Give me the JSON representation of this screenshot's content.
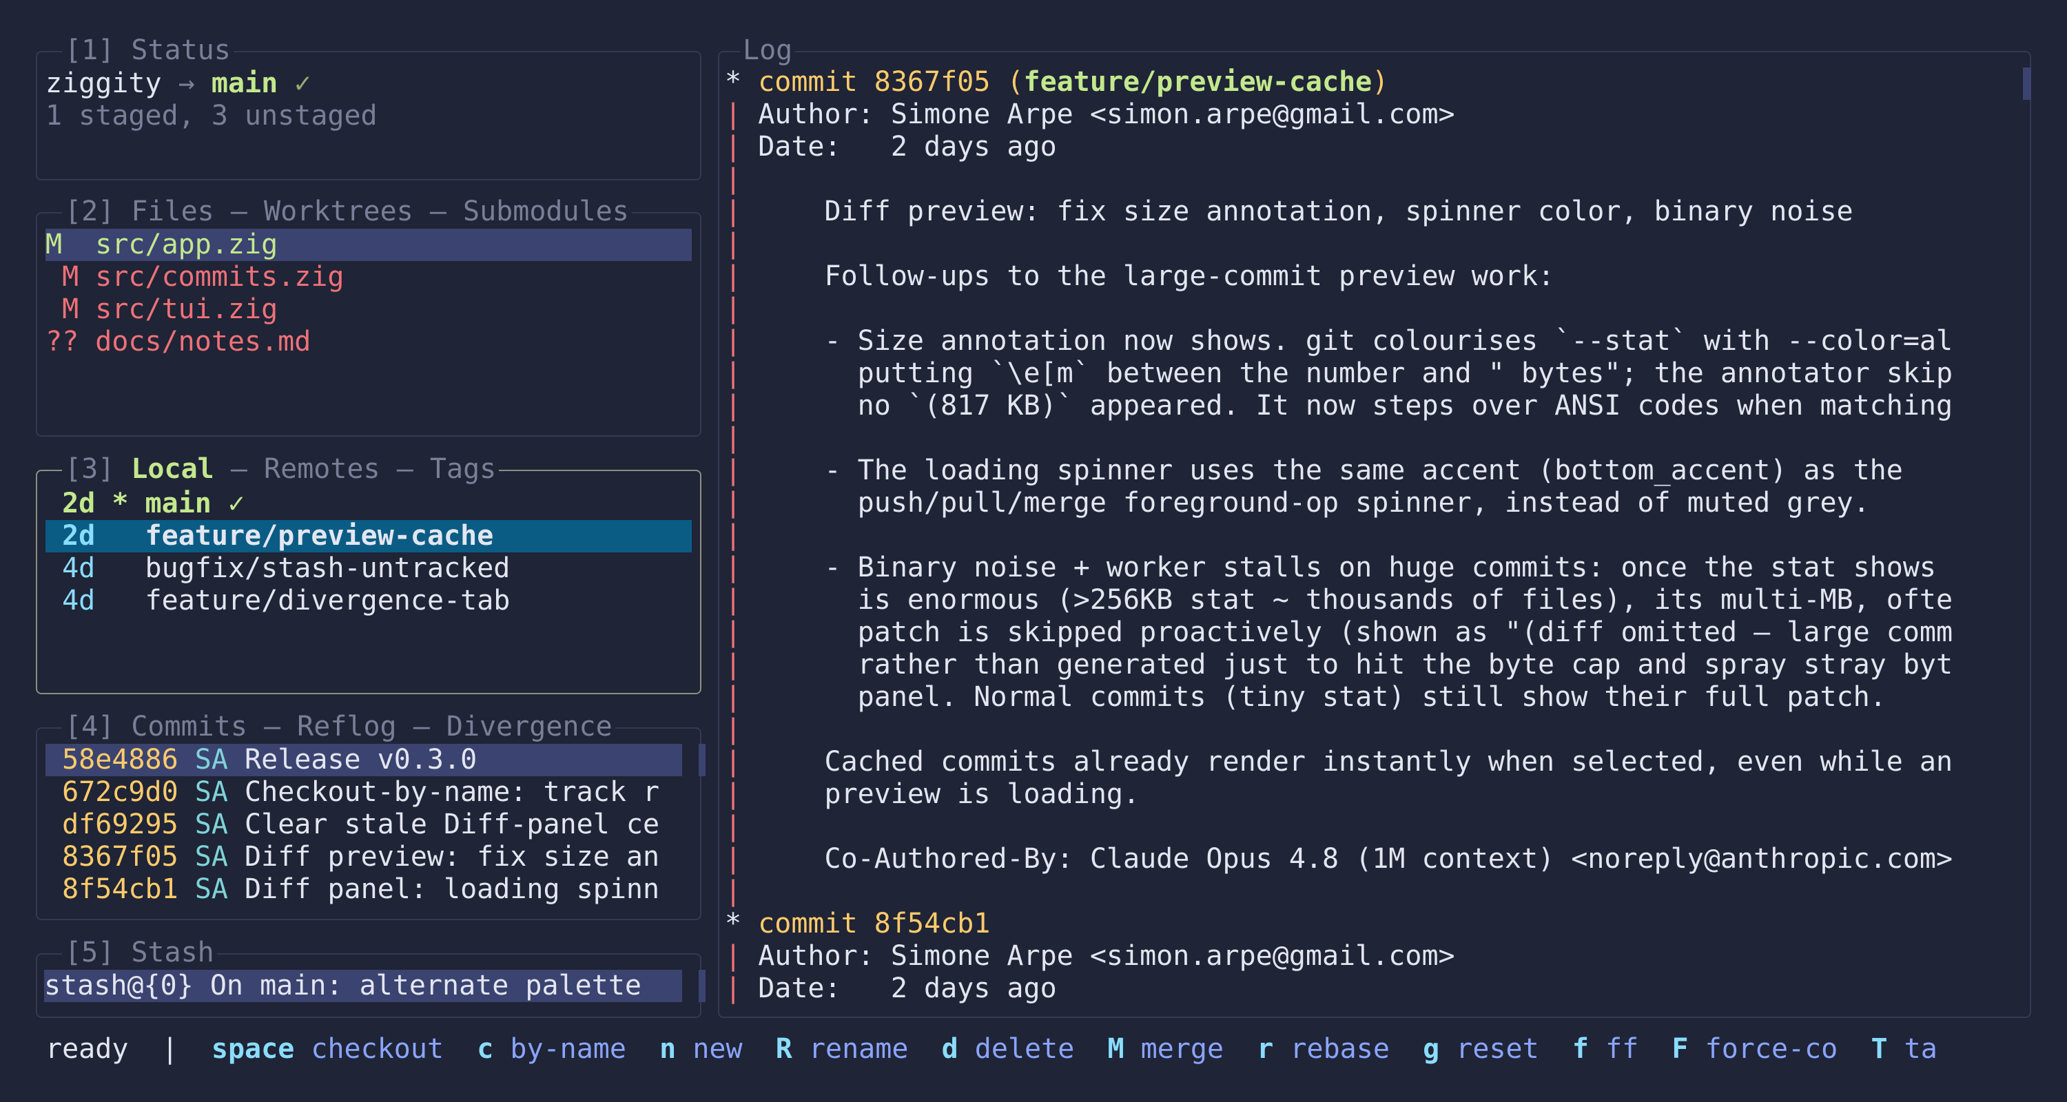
{
  "status_panel": {
    "title": "[1] Status",
    "repo": "ziggity",
    "arrow": "→",
    "branch": "main",
    "check": "✓",
    "summary": "1 staged, 3 unstaged"
  },
  "files_panel": {
    "title_prefix": "[2]",
    "title": "Files – Worktrees – Submodules",
    "items": [
      {
        "status": "M ",
        "path": "src/app.zig"
      },
      {
        "status": " M",
        "path": "src/commits.zig"
      },
      {
        "status": " M",
        "path": "src/tui.zig"
      },
      {
        "status": "??",
        "path": "docs/notes.md"
      }
    ]
  },
  "branches_panel": {
    "title_prefix": "[3]",
    "tabs": [
      "Local",
      "Remotes",
      "Tags"
    ],
    "separator": "–",
    "items": [
      {
        "age": "2d",
        "marker": "*",
        "name": "main",
        "check": "✓"
      },
      {
        "age": "2d",
        "marker": " ",
        "name": "feature/preview-cache",
        "check": ""
      },
      {
        "age": "4d",
        "marker": " ",
        "name": "bugfix/stash-untracked",
        "check": ""
      },
      {
        "age": "4d",
        "marker": " ",
        "name": "feature/divergence-tab",
        "check": ""
      }
    ]
  },
  "commits_panel": {
    "title": "[4] Commits – Reflog – Divergence",
    "items": [
      {
        "hash": "58e4886",
        "author": "SA",
        "message": "Release v0.3.0"
      },
      {
        "hash": "672c9d0",
        "author": "SA",
        "message": "Checkout-by-name: track r"
      },
      {
        "hash": "df69295",
        "author": "SA",
        "message": "Clear stale Diff-panel ce"
      },
      {
        "hash": "8367f05",
        "author": "SA",
        "message": "Diff preview: fix size an"
      },
      {
        "hash": "8f54cb1",
        "author": "SA",
        "message": "Diff panel: loading spinn"
      }
    ]
  },
  "stash_panel": {
    "title": "[5] Stash",
    "items": [
      {
        "ref": "stash@{0}",
        "message": "On main: alternate palette"
      }
    ]
  },
  "log_panel": {
    "title": "Log",
    "commit1": {
      "star": "*",
      "commit_word": "commit",
      "hash": "8367f05",
      "ref_open": "(",
      "ref": "feature/preview-cache",
      "ref_close": ")",
      "author_line": "Author: Simone Arpe <simon.arpe@gmail.com>",
      "date_line": "Date:   2 days ago",
      "body": [
        "",
        "    Diff preview: fix size annotation, spinner color, binary noise",
        "",
        "    Follow-ups to the large-commit preview work:",
        "",
        "    - Size annotation now shows. git colourises `--stat` with --color=al",
        "      putting `\\e[m` between the number and \" bytes\"; the annotator skip",
        "      no `(817 KB)` appeared. It now steps over ANSI codes when matching",
        "",
        "    - The loading spinner uses the same accent (bottom_accent) as the",
        "      push/pull/merge foreground-op spinner, instead of muted grey.",
        "",
        "    - Binary noise + worker stalls on huge commits: once the stat shows",
        "      is enormous (>256KB stat ~ thousands of files), its multi-MB, ofte",
        "      patch is skipped proactively (shown as \"(diff omitted — large comm",
        "      rather than generated just to hit the byte cap and spray stray byt",
        "      panel. Normal commits (tiny stat) still show their full patch.",
        "",
        "    Cached commits already render instantly when selected, even while an",
        "    preview is loading.",
        "",
        "    Co-Authored-By: Claude Opus 4.8 (1M context) <noreply@anthropic.com>",
        ""
      ]
    },
    "commit2": {
      "star": "*",
      "commit_word": "commit",
      "hash": "8f54cb1",
      "author_line": "Author: Simone Arpe <simon.arpe@gmail.com>",
      "date_line": "Date:   2 days ago"
    },
    "graph_bar": "|"
  },
  "status_bar": {
    "state": "ready",
    "divider": "|",
    "keys": [
      {
        "key": "space",
        "action": "checkout"
      },
      {
        "key": "c",
        "action": "by-name"
      },
      {
        "key": "n",
        "action": "new"
      },
      {
        "key": "R",
        "action": "rename"
      },
      {
        "key": "d",
        "action": "delete"
      },
      {
        "key": "M",
        "action": "merge"
      },
      {
        "key": "r",
        "action": "rebase"
      },
      {
        "key": "g",
        "action": "reset"
      },
      {
        "key": "f",
        "action": "ff"
      },
      {
        "key": "F",
        "action": "force-co"
      },
      {
        "key": "T",
        "action": "ta"
      }
    ]
  }
}
